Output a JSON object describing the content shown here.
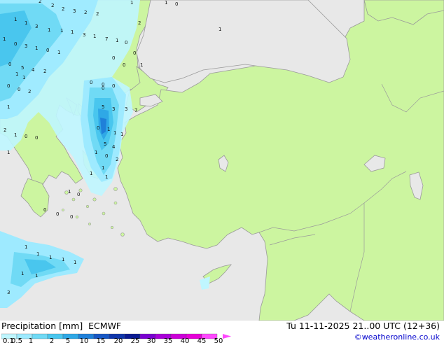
{
  "header_title": "Precipitation [mm]  ECMWF",
  "valid_time": "Tu 11-11-2025 21..00 UTC (12+36)",
  "credit": "©weatheronline.co.uk",
  "colors": {
    "land": "#ccf5a0",
    "sea": "#e8e8e8",
    "coast": "#9a9a9a"
  },
  "legend": {
    "ticks": [
      "0.1",
      "0.5",
      "1",
      "2",
      "5",
      "10",
      "15",
      "20",
      "25",
      "30",
      "35",
      "40",
      "45",
      "50"
    ],
    "colors": [
      "#bff6ff",
      "#9eeaff",
      "#70daf5",
      "#49c6ee",
      "#2fa8e6",
      "#1f80d9",
      "#1757c4",
      "#0f36aa",
      "#0a1a90",
      "#7a00d0",
      "#a800d8",
      "#cc00d8",
      "#e600d8",
      "#ff48ff"
    ]
  },
  "map_values": [
    "2",
    "2",
    "2",
    "3",
    "2",
    "2",
    "1",
    "1",
    "0",
    "1",
    "1",
    "3",
    "1",
    "1",
    "1",
    "3",
    "1",
    "7",
    "1",
    "0",
    "2",
    "0",
    "3",
    "1",
    "0",
    "1",
    "1",
    "0",
    "5",
    "4",
    "2",
    "0",
    "0",
    "2",
    "1",
    "2",
    "1",
    "0",
    "0",
    "1",
    "0",
    "0",
    "0",
    "5",
    "3",
    "3",
    "7",
    "0",
    "1",
    "1",
    "1",
    "5",
    "4",
    "1",
    "0",
    "2",
    "1",
    "1",
    "1",
    "1",
    "1",
    "1",
    "1",
    "1",
    "1",
    "1",
    "3",
    "1",
    "0",
    "0",
    "0",
    "0",
    "0",
    "0",
    "0",
    "0",
    "1",
    "1",
    "1",
    "1"
  ]
}
